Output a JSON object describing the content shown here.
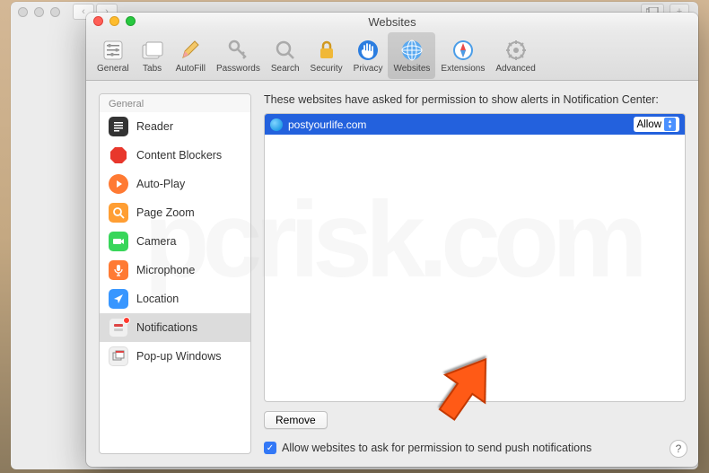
{
  "window": {
    "title": "Websites"
  },
  "toolbar": {
    "items": [
      {
        "label": "General"
      },
      {
        "label": "Tabs"
      },
      {
        "label": "AutoFill"
      },
      {
        "label": "Passwords"
      },
      {
        "label": "Search"
      },
      {
        "label": "Security"
      },
      {
        "label": "Privacy"
      },
      {
        "label": "Websites"
      },
      {
        "label": "Extensions"
      },
      {
        "label": "Advanced"
      }
    ]
  },
  "sidebar": {
    "header": "General",
    "items": [
      {
        "label": "Reader"
      },
      {
        "label": "Content Blockers"
      },
      {
        "label": "Auto-Play"
      },
      {
        "label": "Page Zoom"
      },
      {
        "label": "Camera"
      },
      {
        "label": "Microphone"
      },
      {
        "label": "Location"
      },
      {
        "label": "Notifications"
      },
      {
        "label": "Pop-up Windows"
      }
    ]
  },
  "main": {
    "description": "These websites have asked for permission to show alerts in Notification Center:",
    "rows": [
      {
        "site": "postyourlife.com",
        "permission": "Allow"
      }
    ],
    "remove_label": "Remove",
    "checkbox_label": "Allow websites to ask for permission to send push notifications",
    "checkbox_checked": true
  },
  "help": "?"
}
